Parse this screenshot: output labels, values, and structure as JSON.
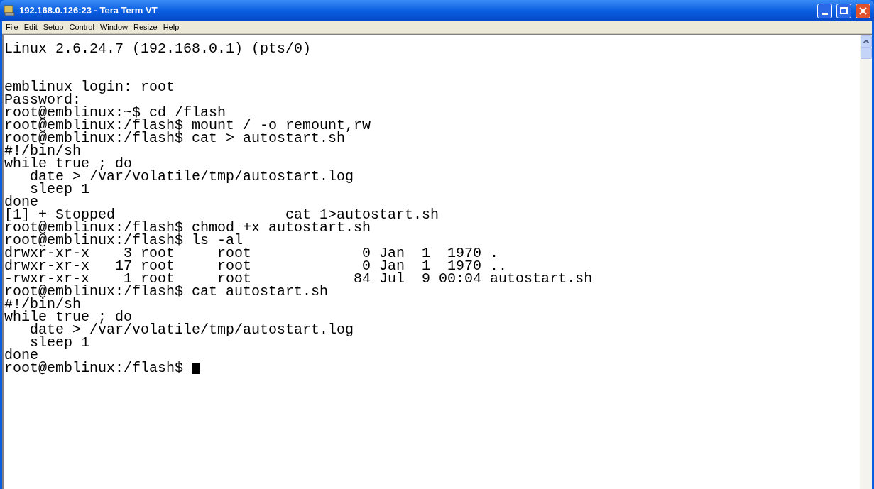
{
  "window": {
    "title": "192.168.0.126:23 - Tera Term VT"
  },
  "menu": [
    "File",
    "Edit",
    "Setup",
    "Control",
    "Window",
    "Resize",
    "Help"
  ],
  "terminal": {
    "banner": "Linux 2.6.24.7 (192.168.0.1) (pts/0)",
    "lines": [
      "emblinux login: root",
      "Password:",
      "root@emblinux:~$ cd /flash",
      "root@emblinux:/flash$ mount / -o remount,rw",
      "root@emblinux:/flash$ cat > autostart.sh",
      "#!/bin/sh",
      "while true ; do",
      "   date > /var/volatile/tmp/autostart.log",
      "   sleep 1",
      "done",
      "[1] + Stopped                    cat 1>autostart.sh",
      "root@emblinux:/flash$ chmod +x autostart.sh",
      "root@emblinux:/flash$ ls -al",
      "drwxr-xr-x    3 root     root             0 Jan  1  1970 .",
      "drwxr-xr-x   17 root     root             0 Jan  1  1970 ..",
      "-rwxr-xr-x    1 root     root            84 Jul  9 00:04 autostart.sh",
      "root@emblinux:/flash$ cat autostart.sh",
      "#!/bin/sh",
      "while true ; do",
      "   date > /var/volatile/tmp/autostart.log",
      "   sleep 1",
      "done",
      "root@emblinux:/flash$ "
    ],
    "cursor_visible": true
  }
}
